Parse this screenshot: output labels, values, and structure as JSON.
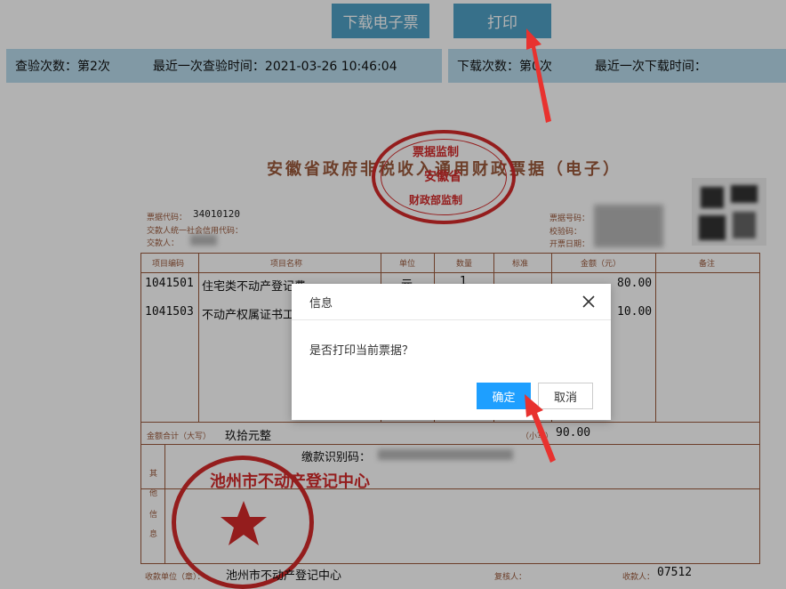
{
  "toolbar": {
    "download_label": "下载电子票",
    "print_label": "打印"
  },
  "info_left": {
    "check_count": "查验次数：第2次",
    "last_check": "最近一次查验时间：2021-03-26 10:46:04"
  },
  "info_right": {
    "download_count": "下载次数：第0次",
    "last_download": "最近一次下载时间："
  },
  "invoice": {
    "title": "安徽省政府非税收入通用财政票据（电子）",
    "code_label": "票据代码：",
    "code_value": "34010120",
    "payer_credit_label": "交款人统一社会信用代码：",
    "payer_label": "交款人：",
    "no_label": "票据号码：",
    "check_code_label": "校验码：",
    "issue_date_label": "开票日期：",
    "headers": [
      "项目编码",
      "项目名称",
      "单位",
      "数量",
      "标准",
      "金额（元）",
      "备注"
    ],
    "rows": [
      {
        "code": "1041501",
        "name": "住宅类不动产登记费",
        "unit": "元",
        "qty": "1",
        "amount": "80.00"
      },
      {
        "code": "1041503",
        "name": "不动产权属证书工本费",
        "unit": "",
        "qty": "",
        "amount": "10.00"
      }
    ],
    "total_label": "金额合计（大写）",
    "total_upper": "玖拾元整",
    "total_small_label": "（小写）",
    "total_small": "90.00",
    "pay_id_label": "缴款识别码：",
    "other_label": [
      "其",
      "他",
      "信",
      "息"
    ],
    "receiver_label": "收款单位（章）：",
    "receiver_value": "池州市不动产登记中心",
    "reviewer_label": "复核人：",
    "payee_label": "收款人：",
    "payee_value": "07512",
    "seal_top": {
      "line1": "票据监制",
      "line2": "安徽省",
      "line3": "财政部监制"
    },
    "seal_bottom": {
      "text": "池州市不动产登记中心"
    }
  },
  "dialog": {
    "title": "信息",
    "message": "是否打印当前票据？",
    "ok_label": "确定",
    "cancel_label": "取消"
  },
  "colors": {
    "accent": "#1e9fff",
    "toolbar": "#4fa1c6",
    "infobar": "#b9dcec",
    "seal": "#d42a2a",
    "arrow": "#e8322f"
  }
}
